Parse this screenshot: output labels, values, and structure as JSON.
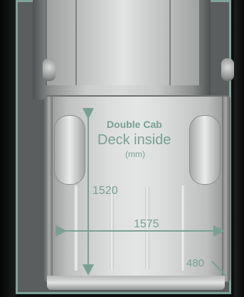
{
  "labels": {
    "cab_type": "Double Cab",
    "heading": "Deck inside",
    "unit": "(mm)"
  },
  "dimensions": {
    "deck_length": "1520",
    "deck_width": "1575",
    "tailgate": "480"
  },
  "colors": {
    "accent": "#7aa092",
    "frame": "#7fa39a",
    "background": "#0c0f0e"
  }
}
